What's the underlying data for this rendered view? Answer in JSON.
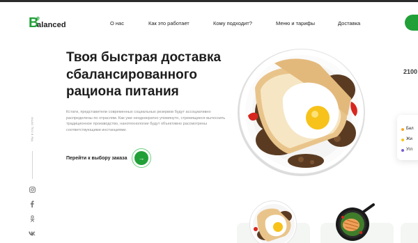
{
  "logo": {
    "big_letter": "B",
    "small_letter": "e",
    "rest": "alanced"
  },
  "nav": {
    "items": [
      {
        "label": "О нас"
      },
      {
        "label": "Как это работает"
      },
      {
        "label": "Кому подходит?"
      },
      {
        "label": "Меню и тарифы"
      },
      {
        "label": "Доставка"
      }
    ]
  },
  "hero": {
    "title_line_1": "Твоя быстрая доставка",
    "title_line_2": "сбалансированного",
    "title_line_3": "рациона питания",
    "description": "Кстати, представители современных социальных резервов будут ассоциативно распределены по отраслям. Как уже неоднократно упомянуто, стремящиеся вытеснить традиционное производство, нанотехнологии будут объективно рассмотрены соответствующими инстанциями.",
    "order_link": "Перейти к выбору заказа",
    "order_arrow": "→"
  },
  "social": {
    "follow_text": "Мы в соц. сетях",
    "icons": [
      "instagram-icon",
      "facebook-icon",
      "odnoklassniki-icon",
      "vk-icon"
    ]
  },
  "right_panel": {
    "price": "2100",
    "legend": [
      {
        "label": "Бел",
        "color": "#f5a623"
      },
      {
        "label": "Жи",
        "color": "#f5c518"
      },
      {
        "label": "Угл",
        "color": "#7b5cd6"
      }
    ]
  },
  "colors": {
    "accent": "#21a038",
    "text_dark": "#1c1c1c",
    "text_muted": "#8c8c8c"
  }
}
